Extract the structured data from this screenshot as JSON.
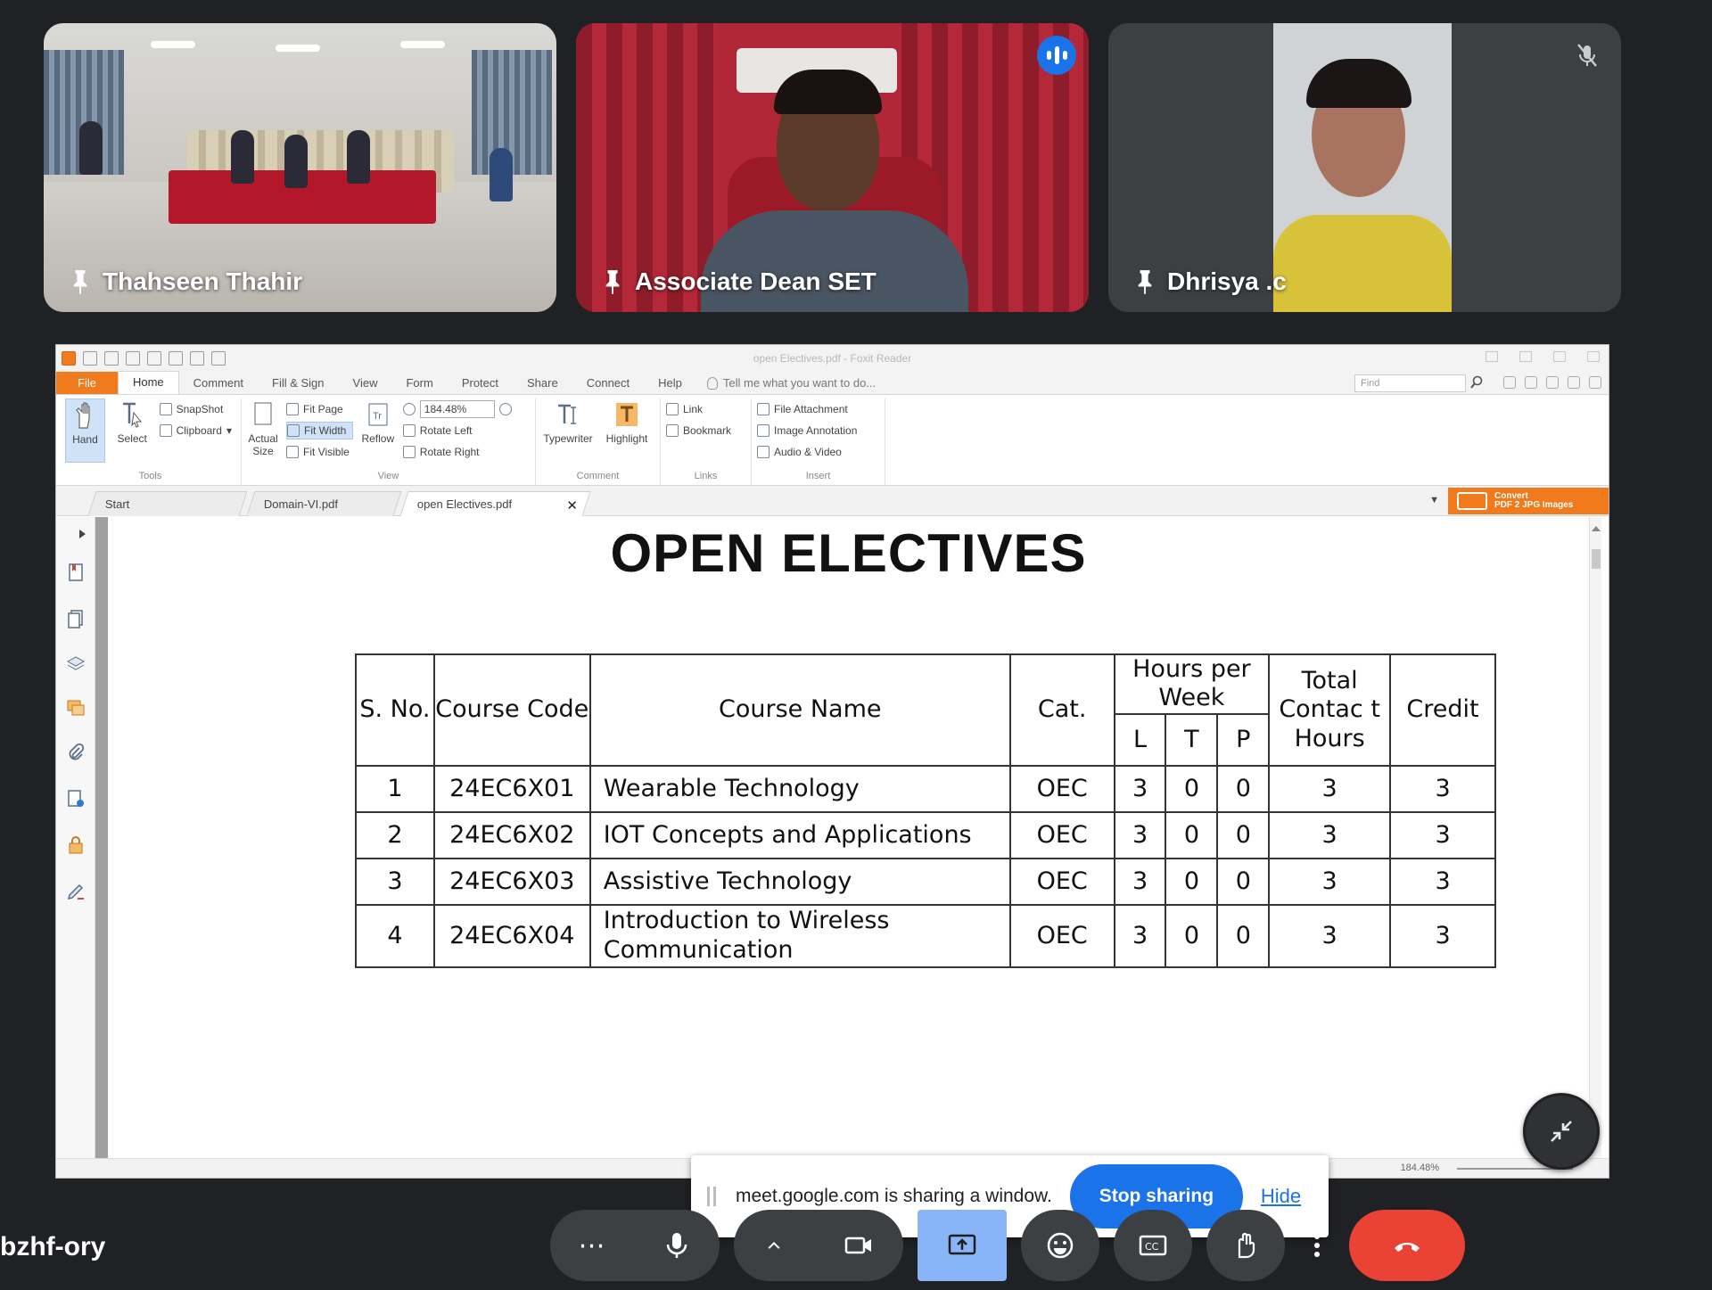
{
  "participants": [
    {
      "name": "Thahseen Thahir",
      "pinned": true
    },
    {
      "name": "Associate Dean SET",
      "pinned": true,
      "speaking": true
    },
    {
      "name": "Dhrisya .c",
      "pinned": true,
      "muted": true
    }
  ],
  "app": {
    "window_title": "open Electives.pdf - Foxit Reader",
    "menu": [
      "File",
      "Home",
      "Comment",
      "Fill & Sign",
      "View",
      "Form",
      "Protect",
      "Share",
      "Connect",
      "Help"
    ],
    "tell_me": "Tell me what you want to do...",
    "find_placeholder": "Find",
    "ribbon": {
      "hand": "Hand",
      "select": "Select",
      "snapshot": "SnapShot",
      "clipboard": "Clipboard",
      "tools_label": "Tools",
      "actual_size": "Actual Size",
      "fit_page": "Fit Page",
      "fit_width": "Fit Width",
      "fit_visible": "Fit Visible",
      "reflow": "Reflow",
      "zoom": "184.48%",
      "rotate_left": "Rotate Left",
      "rotate_right": "Rotate Right",
      "view_label": "View",
      "typewriter": "Typewriter",
      "highlight": "Highlight",
      "comment_label": "Comment",
      "link": "Link",
      "bookmark": "Bookmark",
      "links_label": "Links",
      "file_attachment": "File Attachment",
      "image_annotation": "Image Annotation",
      "audio_video": "Audio & Video",
      "insert_label": "Insert"
    },
    "tabs": [
      "Start",
      "Domain-VI.pdf",
      "open Electives.pdf"
    ],
    "convert_button": {
      "line1": "Convert",
      "line2": "PDF 2 JPG Images"
    },
    "status_zoom": "184.48%"
  },
  "document": {
    "heading": "OPEN ELECTIVES",
    "headers": {
      "sno": "S. No.",
      "code": "Course Code",
      "name": "Course Name",
      "cat": "Cat.",
      "hours": "Hours per Week",
      "l": "L",
      "t": "T",
      "p": "P",
      "contact": "Total Contac t Hours",
      "credit": "Credit"
    },
    "rows": [
      {
        "sno": "1",
        "code": "24EC6X01",
        "name": "Wearable Technology",
        "cat": "OEC",
        "l": "3",
        "t": "0",
        "p": "0",
        "contact": "3",
        "credit": "3"
      },
      {
        "sno": "2",
        "code": "24EC6X02",
        "name": "IOT Concepts and Applications",
        "cat": "OEC",
        "l": "3",
        "t": "0",
        "p": "0",
        "contact": "3",
        "credit": "3"
      },
      {
        "sno": "3",
        "code": "24EC6X03",
        "name": "Assistive Technology",
        "cat": "OEC",
        "l": "3",
        "t": "0",
        "p": "0",
        "contact": "3",
        "credit": "3"
      },
      {
        "sno": "4",
        "code": "24EC6X04",
        "name": "Introduction to Wireless Communication",
        "cat": "OEC",
        "l": "3",
        "t": "0",
        "p": "0",
        "contact": "3",
        "credit": "3"
      }
    ]
  },
  "sharing": {
    "message": "meet.google.com is sharing a window.",
    "stop": "Stop sharing",
    "hide": "Hide"
  },
  "meeting_code": "bzhf-ory",
  "colors": {
    "accent": "#1a73e8",
    "end_call": "#ea4335",
    "foxit_orange": "#f07a1c"
  }
}
